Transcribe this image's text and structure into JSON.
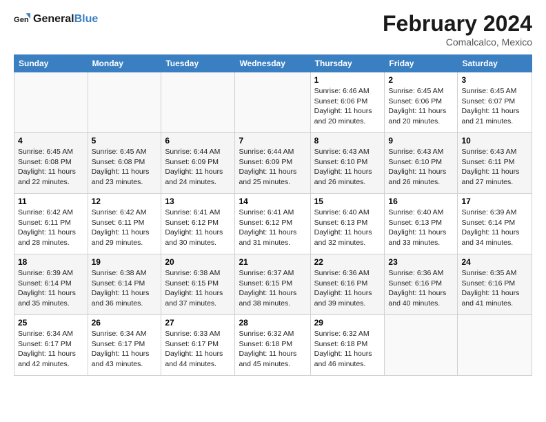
{
  "logo": {
    "text_general": "General",
    "text_blue": "Blue"
  },
  "header": {
    "month_year": "February 2024",
    "location": "Comalcalco, Mexico"
  },
  "days_of_week": [
    "Sunday",
    "Monday",
    "Tuesday",
    "Wednesday",
    "Thursday",
    "Friday",
    "Saturday"
  ],
  "weeks": [
    [
      {
        "day": "",
        "info": ""
      },
      {
        "day": "",
        "info": ""
      },
      {
        "day": "",
        "info": ""
      },
      {
        "day": "",
        "info": ""
      },
      {
        "day": "1",
        "info": "Sunrise: 6:46 AM\nSunset: 6:06 PM\nDaylight: 11 hours\nand 20 minutes."
      },
      {
        "day": "2",
        "info": "Sunrise: 6:45 AM\nSunset: 6:06 PM\nDaylight: 11 hours\nand 20 minutes."
      },
      {
        "day": "3",
        "info": "Sunrise: 6:45 AM\nSunset: 6:07 PM\nDaylight: 11 hours\nand 21 minutes."
      }
    ],
    [
      {
        "day": "4",
        "info": "Sunrise: 6:45 AM\nSunset: 6:08 PM\nDaylight: 11 hours\nand 22 minutes."
      },
      {
        "day": "5",
        "info": "Sunrise: 6:45 AM\nSunset: 6:08 PM\nDaylight: 11 hours\nand 23 minutes."
      },
      {
        "day": "6",
        "info": "Sunrise: 6:44 AM\nSunset: 6:09 PM\nDaylight: 11 hours\nand 24 minutes."
      },
      {
        "day": "7",
        "info": "Sunrise: 6:44 AM\nSunset: 6:09 PM\nDaylight: 11 hours\nand 25 minutes."
      },
      {
        "day": "8",
        "info": "Sunrise: 6:43 AM\nSunset: 6:10 PM\nDaylight: 11 hours\nand 26 minutes."
      },
      {
        "day": "9",
        "info": "Sunrise: 6:43 AM\nSunset: 6:10 PM\nDaylight: 11 hours\nand 26 minutes."
      },
      {
        "day": "10",
        "info": "Sunrise: 6:43 AM\nSunset: 6:11 PM\nDaylight: 11 hours\nand 27 minutes."
      }
    ],
    [
      {
        "day": "11",
        "info": "Sunrise: 6:42 AM\nSunset: 6:11 PM\nDaylight: 11 hours\nand 28 minutes."
      },
      {
        "day": "12",
        "info": "Sunrise: 6:42 AM\nSunset: 6:11 PM\nDaylight: 11 hours\nand 29 minutes."
      },
      {
        "day": "13",
        "info": "Sunrise: 6:41 AM\nSunset: 6:12 PM\nDaylight: 11 hours\nand 30 minutes."
      },
      {
        "day": "14",
        "info": "Sunrise: 6:41 AM\nSunset: 6:12 PM\nDaylight: 11 hours\nand 31 minutes."
      },
      {
        "day": "15",
        "info": "Sunrise: 6:40 AM\nSunset: 6:13 PM\nDaylight: 11 hours\nand 32 minutes."
      },
      {
        "day": "16",
        "info": "Sunrise: 6:40 AM\nSunset: 6:13 PM\nDaylight: 11 hours\nand 33 minutes."
      },
      {
        "day": "17",
        "info": "Sunrise: 6:39 AM\nSunset: 6:14 PM\nDaylight: 11 hours\nand 34 minutes."
      }
    ],
    [
      {
        "day": "18",
        "info": "Sunrise: 6:39 AM\nSunset: 6:14 PM\nDaylight: 11 hours\nand 35 minutes."
      },
      {
        "day": "19",
        "info": "Sunrise: 6:38 AM\nSunset: 6:14 PM\nDaylight: 11 hours\nand 36 minutes."
      },
      {
        "day": "20",
        "info": "Sunrise: 6:38 AM\nSunset: 6:15 PM\nDaylight: 11 hours\nand 37 minutes."
      },
      {
        "day": "21",
        "info": "Sunrise: 6:37 AM\nSunset: 6:15 PM\nDaylight: 11 hours\nand 38 minutes."
      },
      {
        "day": "22",
        "info": "Sunrise: 6:36 AM\nSunset: 6:16 PM\nDaylight: 11 hours\nand 39 minutes."
      },
      {
        "day": "23",
        "info": "Sunrise: 6:36 AM\nSunset: 6:16 PM\nDaylight: 11 hours\nand 40 minutes."
      },
      {
        "day": "24",
        "info": "Sunrise: 6:35 AM\nSunset: 6:16 PM\nDaylight: 11 hours\nand 41 minutes."
      }
    ],
    [
      {
        "day": "25",
        "info": "Sunrise: 6:34 AM\nSunset: 6:17 PM\nDaylight: 11 hours\nand 42 minutes."
      },
      {
        "day": "26",
        "info": "Sunrise: 6:34 AM\nSunset: 6:17 PM\nDaylight: 11 hours\nand 43 minutes."
      },
      {
        "day": "27",
        "info": "Sunrise: 6:33 AM\nSunset: 6:17 PM\nDaylight: 11 hours\nand 44 minutes."
      },
      {
        "day": "28",
        "info": "Sunrise: 6:32 AM\nSunset: 6:18 PM\nDaylight: 11 hours\nand 45 minutes."
      },
      {
        "day": "29",
        "info": "Sunrise: 6:32 AM\nSunset: 6:18 PM\nDaylight: 11 hours\nand 46 minutes."
      },
      {
        "day": "",
        "info": ""
      },
      {
        "day": "",
        "info": ""
      }
    ]
  ]
}
